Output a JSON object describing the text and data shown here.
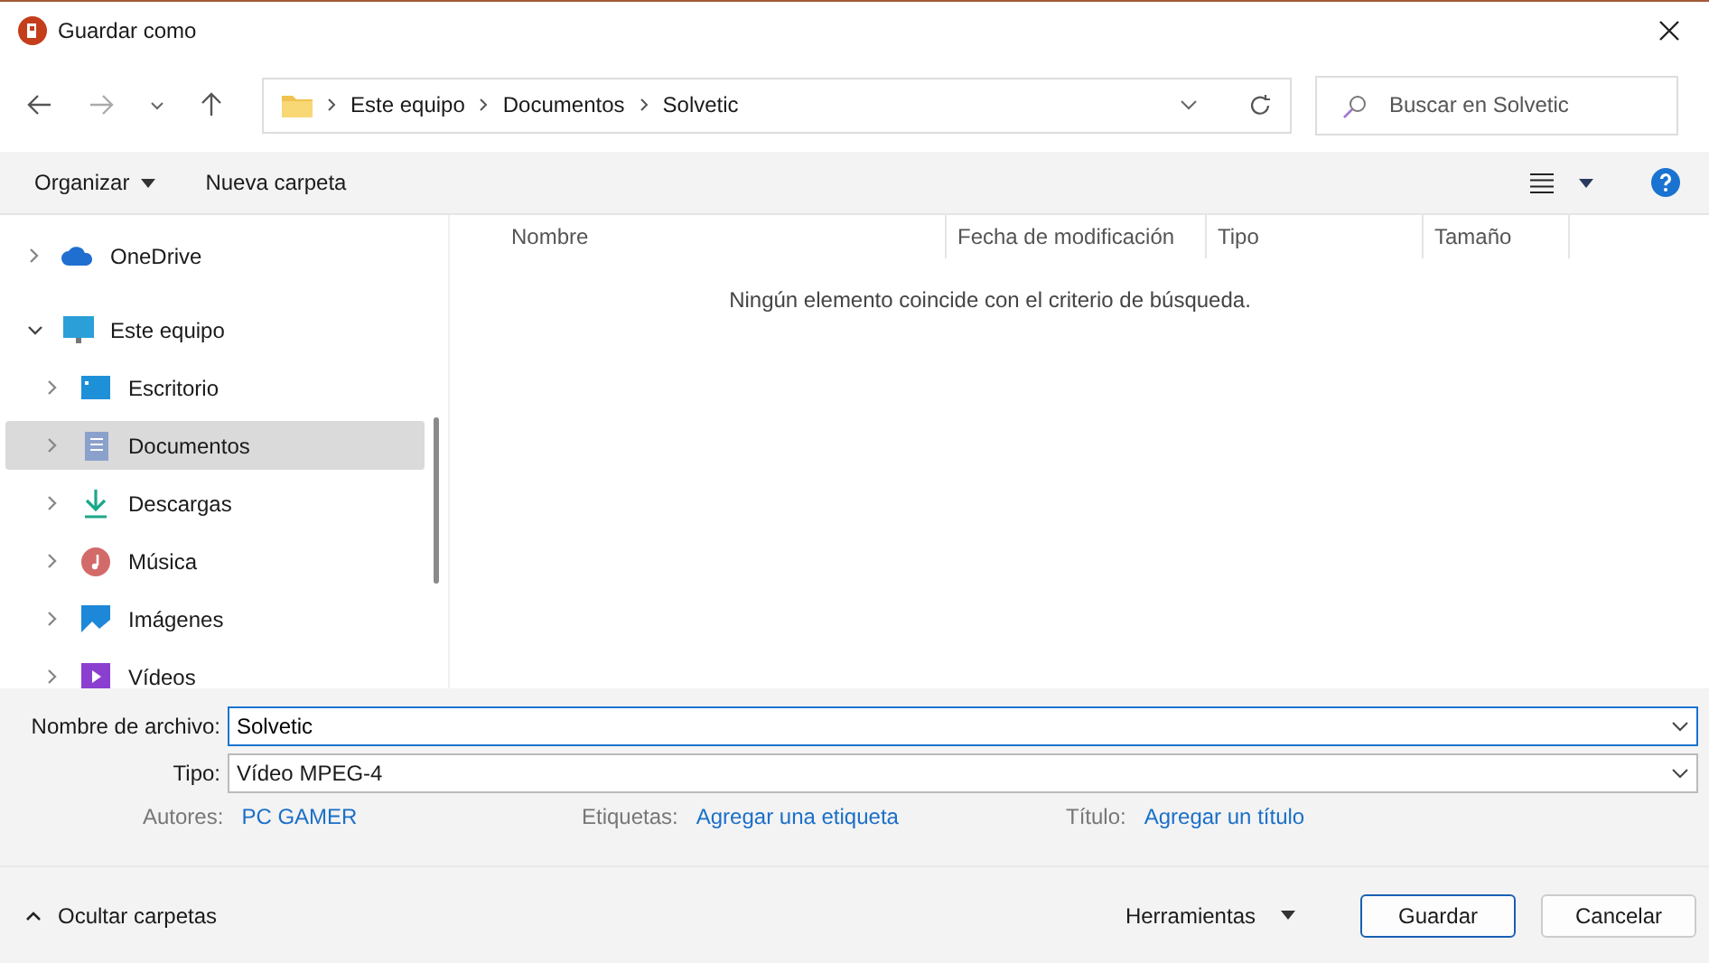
{
  "window": {
    "title": "Guardar como"
  },
  "breadcrumb": [
    "Este equipo",
    "Documentos",
    "Solvetic"
  ],
  "search": {
    "placeholder": "Buscar en Solvetic"
  },
  "toolbar": {
    "organize": "Organizar",
    "new_folder": "Nueva carpeta"
  },
  "sidebar": {
    "items": [
      {
        "label": "OneDrive",
        "expanded": false,
        "selected": false
      },
      {
        "label": "Este equipo",
        "expanded": true,
        "selected": false,
        "children": [
          {
            "label": "Escritorio",
            "expanded": false,
            "selected": false
          },
          {
            "label": "Documentos",
            "expanded": false,
            "selected": true
          },
          {
            "label": "Descargas",
            "expanded": false,
            "selected": false
          },
          {
            "label": "Música",
            "expanded": false,
            "selected": false
          },
          {
            "label": "Imágenes",
            "expanded": false,
            "selected": false
          },
          {
            "label": "Vídeos",
            "expanded": false,
            "selected": false
          }
        ]
      }
    ]
  },
  "table": {
    "columns": [
      "Nombre",
      "Fecha de modificación",
      "Tipo",
      "Tamaño"
    ],
    "empty_message": "Ningún elemento coincide con el criterio de búsqueda."
  },
  "form": {
    "filename_label": "Nombre de archivo:",
    "filename": "Solvetic",
    "type_label": "Tipo:",
    "type": "Vídeo MPEG-4",
    "meta": [
      {
        "label": "Autores:",
        "value": "PC GAMER"
      },
      {
        "label": "Etiquetas:",
        "value": "Agregar una etiqueta"
      },
      {
        "label": "Título:",
        "value": "Agregar un título"
      }
    ]
  },
  "footer": {
    "hide_folders": "Ocultar carpetas",
    "tools": "Herramientas",
    "save": "Guardar",
    "cancel": "Cancelar"
  }
}
